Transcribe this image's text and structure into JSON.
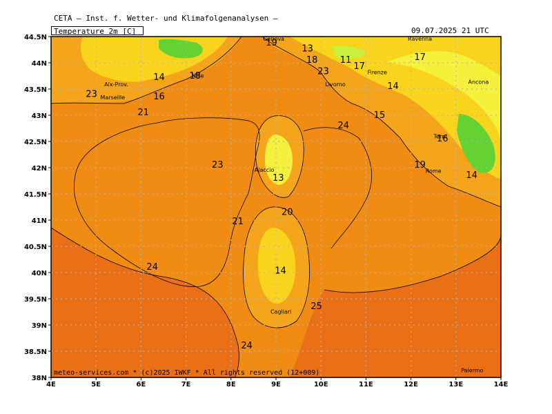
{
  "header": {
    "organization": "CETA — Inst. f. Wetter- und Klimafolgenanalysen —",
    "title": "Temperature 2m [C]",
    "datetime": "09.07.2025 21 UTC"
  },
  "footer": {
    "credit": "meteo-services.com * (c)2025 IWKF * All rights reserved (12+009)"
  },
  "axes": {
    "lon_ticks": [
      "4E",
      "5E",
      "6E",
      "7E",
      "8E",
      "9E",
      "10E",
      "11E",
      "12E",
      "13E",
      "14E"
    ],
    "lat_ticks": [
      "44.5N",
      "44N",
      "43.5N",
      "43N",
      "42.5N",
      "42N",
      "41.5N",
      "41N",
      "40.5N",
      "40N",
      "39.5N",
      "39N",
      "38.5N",
      "38N"
    ]
  },
  "colors": {
    "sea": "#f08c14",
    "warm_sea": "#ea7018",
    "coast_orange": "#f5a51c",
    "yellow": "#f8d41c",
    "light_yellow": "#f4f03c",
    "green_yellow": "#c8f03c",
    "green": "#64d232"
  },
  "cities": [
    {
      "name": "Genova",
      "lon": 8.95,
      "lat": 44.42
    },
    {
      "name": "Ravenna",
      "lon": 12.2,
      "lat": 44.42
    },
    {
      "name": "Nice",
      "lon": 7.26,
      "lat": 43.72
    },
    {
      "name": "Aix-Prov.",
      "lon": 5.45,
      "lat": 43.55
    },
    {
      "name": "Marseille",
      "lon": 5.37,
      "lat": 43.3
    },
    {
      "name": "Firenze",
      "lon": 11.25,
      "lat": 43.78
    },
    {
      "name": "Livorno",
      "lon": 10.32,
      "lat": 43.55
    },
    {
      "name": "Ancona",
      "lon": 13.5,
      "lat": 43.6
    },
    {
      "name": "Terni",
      "lon": 12.65,
      "lat": 42.56
    },
    {
      "name": "Rome",
      "lon": 12.5,
      "lat": 41.9
    },
    {
      "name": "Ajaccio",
      "lon": 8.74,
      "lat": 41.92
    },
    {
      "name": "Cagliari",
      "lon": 9.11,
      "lat": 39.22
    },
    {
      "name": "Palermo",
      "lon": 13.36,
      "lat": 38.1
    }
  ],
  "contour_labels": [
    {
      "text": "19",
      "lon": 8.9,
      "lat": 44.33
    },
    {
      "text": "13",
      "lon": 9.7,
      "lat": 44.22
    },
    {
      "text": "18",
      "lon": 9.8,
      "lat": 44.0
    },
    {
      "text": "11",
      "lon": 10.55,
      "lat": 44.0
    },
    {
      "text": "17",
      "lon": 12.2,
      "lat": 44.05
    },
    {
      "text": "17",
      "lon": 10.85,
      "lat": 43.88
    },
    {
      "text": "23",
      "lon": 10.05,
      "lat": 43.78
    },
    {
      "text": "14",
      "lon": 6.4,
      "lat": 43.67
    },
    {
      "text": "18",
      "lon": 7.2,
      "lat": 43.7
    },
    {
      "text": "23",
      "lon": 4.9,
      "lat": 43.35
    },
    {
      "text": "16",
      "lon": 6.4,
      "lat": 43.3
    },
    {
      "text": "21",
      "lon": 6.05,
      "lat": 43.0
    },
    {
      "text": "14",
      "lon": 11.6,
      "lat": 43.5
    },
    {
      "text": "15",
      "lon": 11.3,
      "lat": 42.95
    },
    {
      "text": "24",
      "lon": 10.5,
      "lat": 42.75
    },
    {
      "text": "16",
      "lon": 12.7,
      "lat": 42.5
    },
    {
      "text": "19",
      "lon": 12.2,
      "lat": 42.0
    },
    {
      "text": "23",
      "lon": 7.7,
      "lat": 42.0
    },
    {
      "text": "13",
      "lon": 9.05,
      "lat": 41.75
    },
    {
      "text": "14",
      "lon": 13.35,
      "lat": 41.8
    },
    {
      "text": "20",
      "lon": 9.25,
      "lat": 41.1
    },
    {
      "text": "21",
      "lon": 8.15,
      "lat": 40.92
    },
    {
      "text": "24",
      "lon": 6.25,
      "lat": 40.05
    },
    {
      "text": "14",
      "lon": 9.1,
      "lat": 39.98
    },
    {
      "text": "25",
      "lon": 9.9,
      "lat": 39.3
    },
    {
      "text": "24",
      "lon": 8.35,
      "lat": 38.55
    }
  ]
}
